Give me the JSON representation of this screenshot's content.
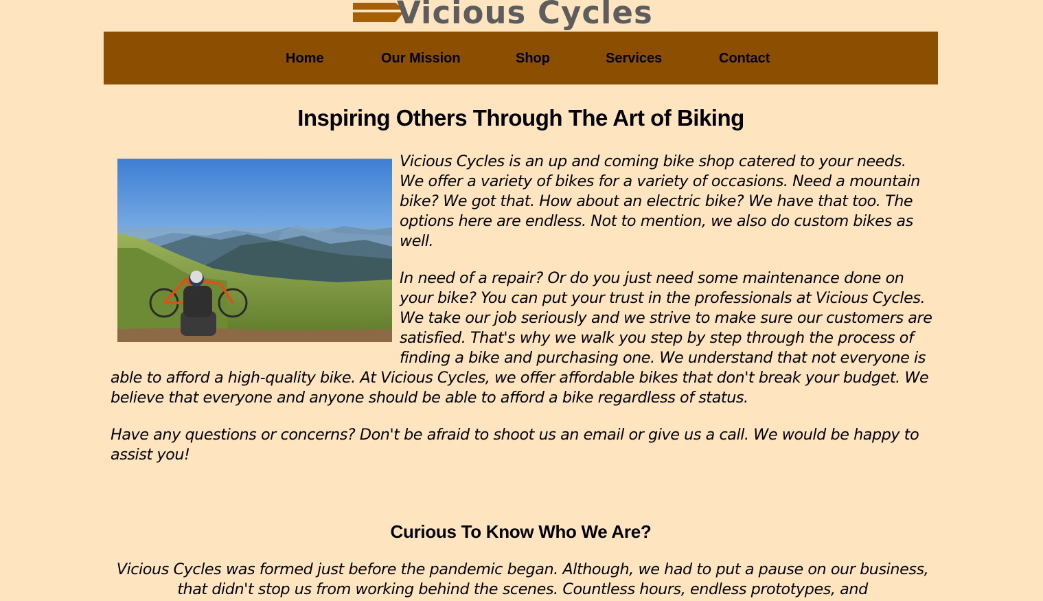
{
  "brand": {
    "name": "Vicious Cycles",
    "logo_bar_color": "#a65f05",
    "logo_text_color": "#5d5d5d"
  },
  "colors": {
    "page_background": "#ffe4c0",
    "nav_background": "#8c4e00"
  },
  "nav": {
    "items": [
      "Home",
      "Our Mission",
      "Shop",
      "Services",
      "Contact"
    ]
  },
  "main": {
    "heading": "Inspiring Others Through The Art of Biking",
    "image_icon": "cyclist-resting-on-mountain-photo",
    "paragraphs": [
      "Vicious Cycles is an up and coming bike shop catered to your needs. We offer a variety of bikes for a variety of occasions. Need a mountain bike? We got that. How about an electric bike? We have that too. The options here are endless. Not to mention, we also do custom bikes as well.",
      "In need of a repair? Or do you just need some maintenance done on your bike? You can put your trust in the professionals at Vicious Cycles. We take our job seriously and we strive to make sure our customers are satisfied. That's why we walk you step by step through the process of finding a bike and purchasing one. We understand that not everyone is able to afford a high-quality bike. At Vicious Cycles, we offer affordable bikes that don't break your budget. We believe that everyone and anyone should be able to afford a bike regardless of status.",
      "Have any questions or concerns? Don't be afraid to shoot us an email or give us a call. We would be happy to assist you!"
    ]
  },
  "about": {
    "heading": "Curious To Know Who We Are?",
    "text": "Vicious Cycles was formed just before the pandemic began. Although, we had to put a pause on our business, that didn't stop us from working behind the scenes. Countless hours, endless prototypes, and"
  }
}
